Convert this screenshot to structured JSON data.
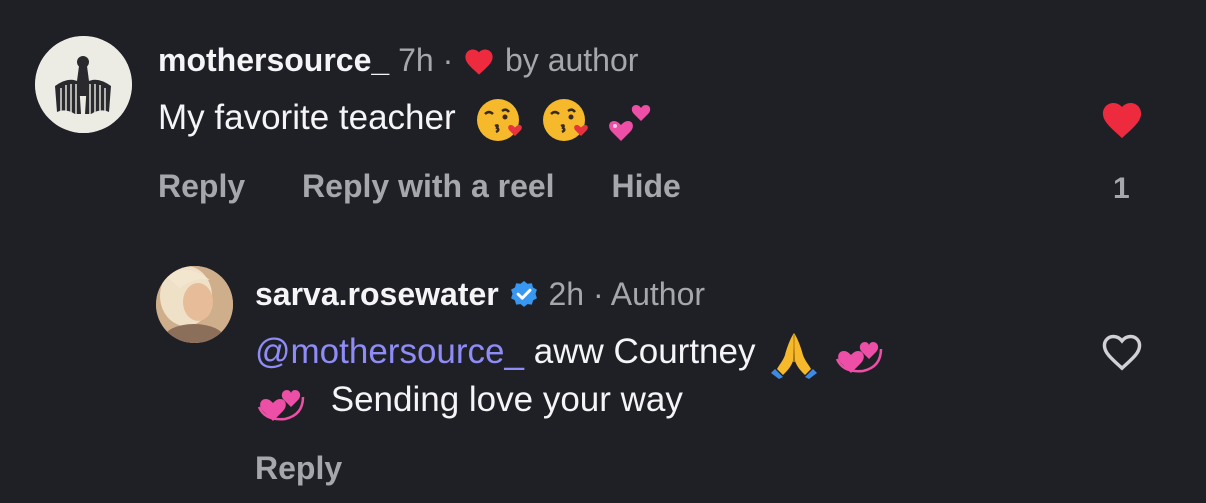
{
  "comment": {
    "username": "mothersource_",
    "time": "7h",
    "separator": "·",
    "liked_by_author_label": "by author",
    "text": "My favorite teacher",
    "emojis": [
      "kissing-heart-emoji",
      "kissing-heart-emoji",
      "two-hearts-emoji"
    ],
    "actions": {
      "reply": "Reply",
      "reply_with_reel": "Reply with a reel",
      "hide": "Hide"
    },
    "like_count": "1",
    "liked": true,
    "like_color": "#ee2a3f"
  },
  "reply": {
    "username": "sarva.rosewater",
    "verified": true,
    "verified_color": "#3897f0",
    "time": "2h",
    "separator": "·",
    "role": "Author",
    "mention": "@mothersource_",
    "text_line1": "aww Courtney",
    "text_line2": "Sending love your way",
    "emojis": [
      "folded-hands-emoji",
      "revolving-hearts-emoji",
      "revolving-hearts-emoji"
    ],
    "actions": {
      "reply": "Reply"
    },
    "liked": false
  },
  "colors": {
    "background": "#1f2026",
    "text": "#f5f5f7",
    "muted": "#a6a7ad",
    "mention": "#8f8cf7"
  }
}
